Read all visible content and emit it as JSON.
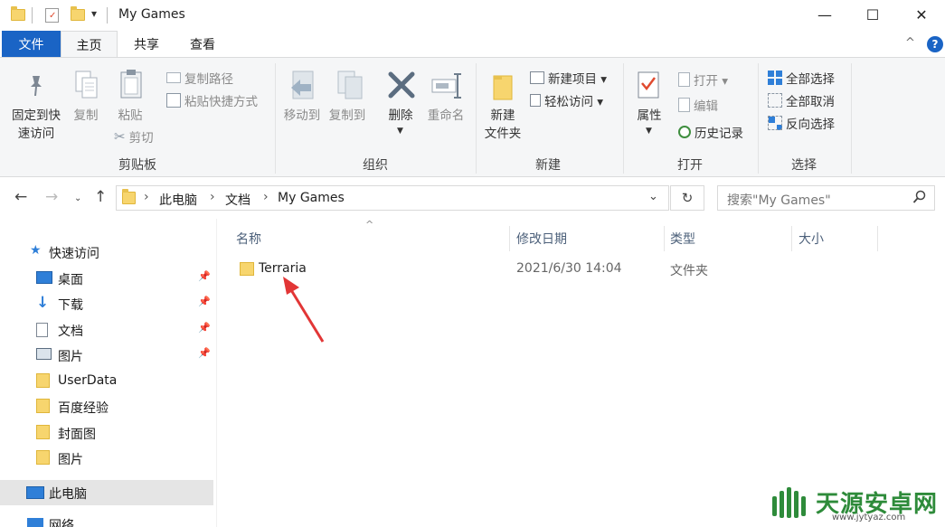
{
  "titlebar": {
    "title": "My Games",
    "qat_dropdown": "▾",
    "minimize": "—",
    "maximize": "☐",
    "close": "✕"
  },
  "ribbon_tabs": {
    "file": "文件",
    "home": "主页",
    "share": "共享",
    "view": "查看",
    "collapse": "^",
    "help": "?"
  },
  "ribbon": {
    "clipboard": {
      "label": "剪贴板",
      "pin_quick_access_line1": "固定到快",
      "pin_quick_access_line2": "速访问",
      "copy": "复制",
      "paste": "粘贴",
      "copy_path": "复制路径",
      "paste_shortcut": "粘贴快捷方式",
      "cut": "剪切"
    },
    "organize": {
      "label": "组织",
      "move_to": "移动到",
      "copy_to": "复制到",
      "delete": "删除",
      "rename": "重命名"
    },
    "new": {
      "label": "新建",
      "new_folder_line1": "新建",
      "new_folder_line2": "文件夹",
      "new_item": "新建项目 ▾",
      "easy_access": "轻松访问 ▾"
    },
    "open": {
      "label": "打开",
      "properties": "属性",
      "open": "打开 ▾",
      "edit": "编辑",
      "history": "历史记录"
    },
    "select": {
      "label": "选择",
      "select_all": "全部选择",
      "select_none": "全部取消",
      "invert": "反向选择"
    }
  },
  "address": {
    "crumbs": [
      "此电脑",
      "文档",
      "My Games"
    ],
    "search_placeholder": "搜索\"My Games\""
  },
  "nav": {
    "quick_access": "快速访问",
    "items": [
      {
        "label": "桌面",
        "pinned": true
      },
      {
        "label": "下载",
        "pinned": true
      },
      {
        "label": "文档",
        "pinned": true
      },
      {
        "label": "图片",
        "pinned": true
      },
      {
        "label": "UserData",
        "pinned": false
      },
      {
        "label": "百度经验",
        "pinned": false
      },
      {
        "label": "封面图",
        "pinned": false
      },
      {
        "label": "图片",
        "pinned": false
      }
    ],
    "this_pc": "此电脑",
    "network": "网络"
  },
  "filelist": {
    "columns": {
      "name": "名称",
      "modified": "修改日期",
      "type": "类型",
      "size": "大小"
    },
    "rows": [
      {
        "name": "Terraria",
        "modified": "2021/6/30 14:04",
        "type": "文件夹",
        "size": ""
      }
    ]
  },
  "watermark": {
    "brand": "天源安卓网",
    "url": "www.jytyaz.com"
  },
  "colors": {
    "file_tab": "#1a64c5",
    "ribbon_bg": "#f5f6f7",
    "folder": "#f7d56e",
    "arrow": "#e23636",
    "selected_nav": "#e5e5e5",
    "watermark_green": "#2e8b3a"
  }
}
